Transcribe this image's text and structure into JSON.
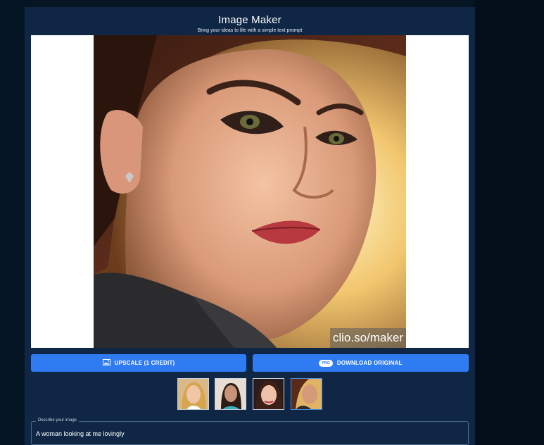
{
  "app": {
    "title": "Image Maker",
    "subtitle": "Bring your ideas to life with a simple text prompt"
  },
  "image": {
    "watermark": "clio.so/maker"
  },
  "actions": {
    "upscale_label": "UPSCALE (1 CREDIT)",
    "upscale_icon": "image-icon",
    "download_label": "DOWNLOAD ORIGINAL",
    "pro_badge": "PRO"
  },
  "thumbnails": {
    "count": 4,
    "selected_index": 3
  },
  "prompt": {
    "legend": "Describe your image",
    "value": "A woman looking at me lovingly"
  },
  "colors": {
    "panel": "#0f2745",
    "accent": "#2f7bf2",
    "page": "#071726"
  }
}
